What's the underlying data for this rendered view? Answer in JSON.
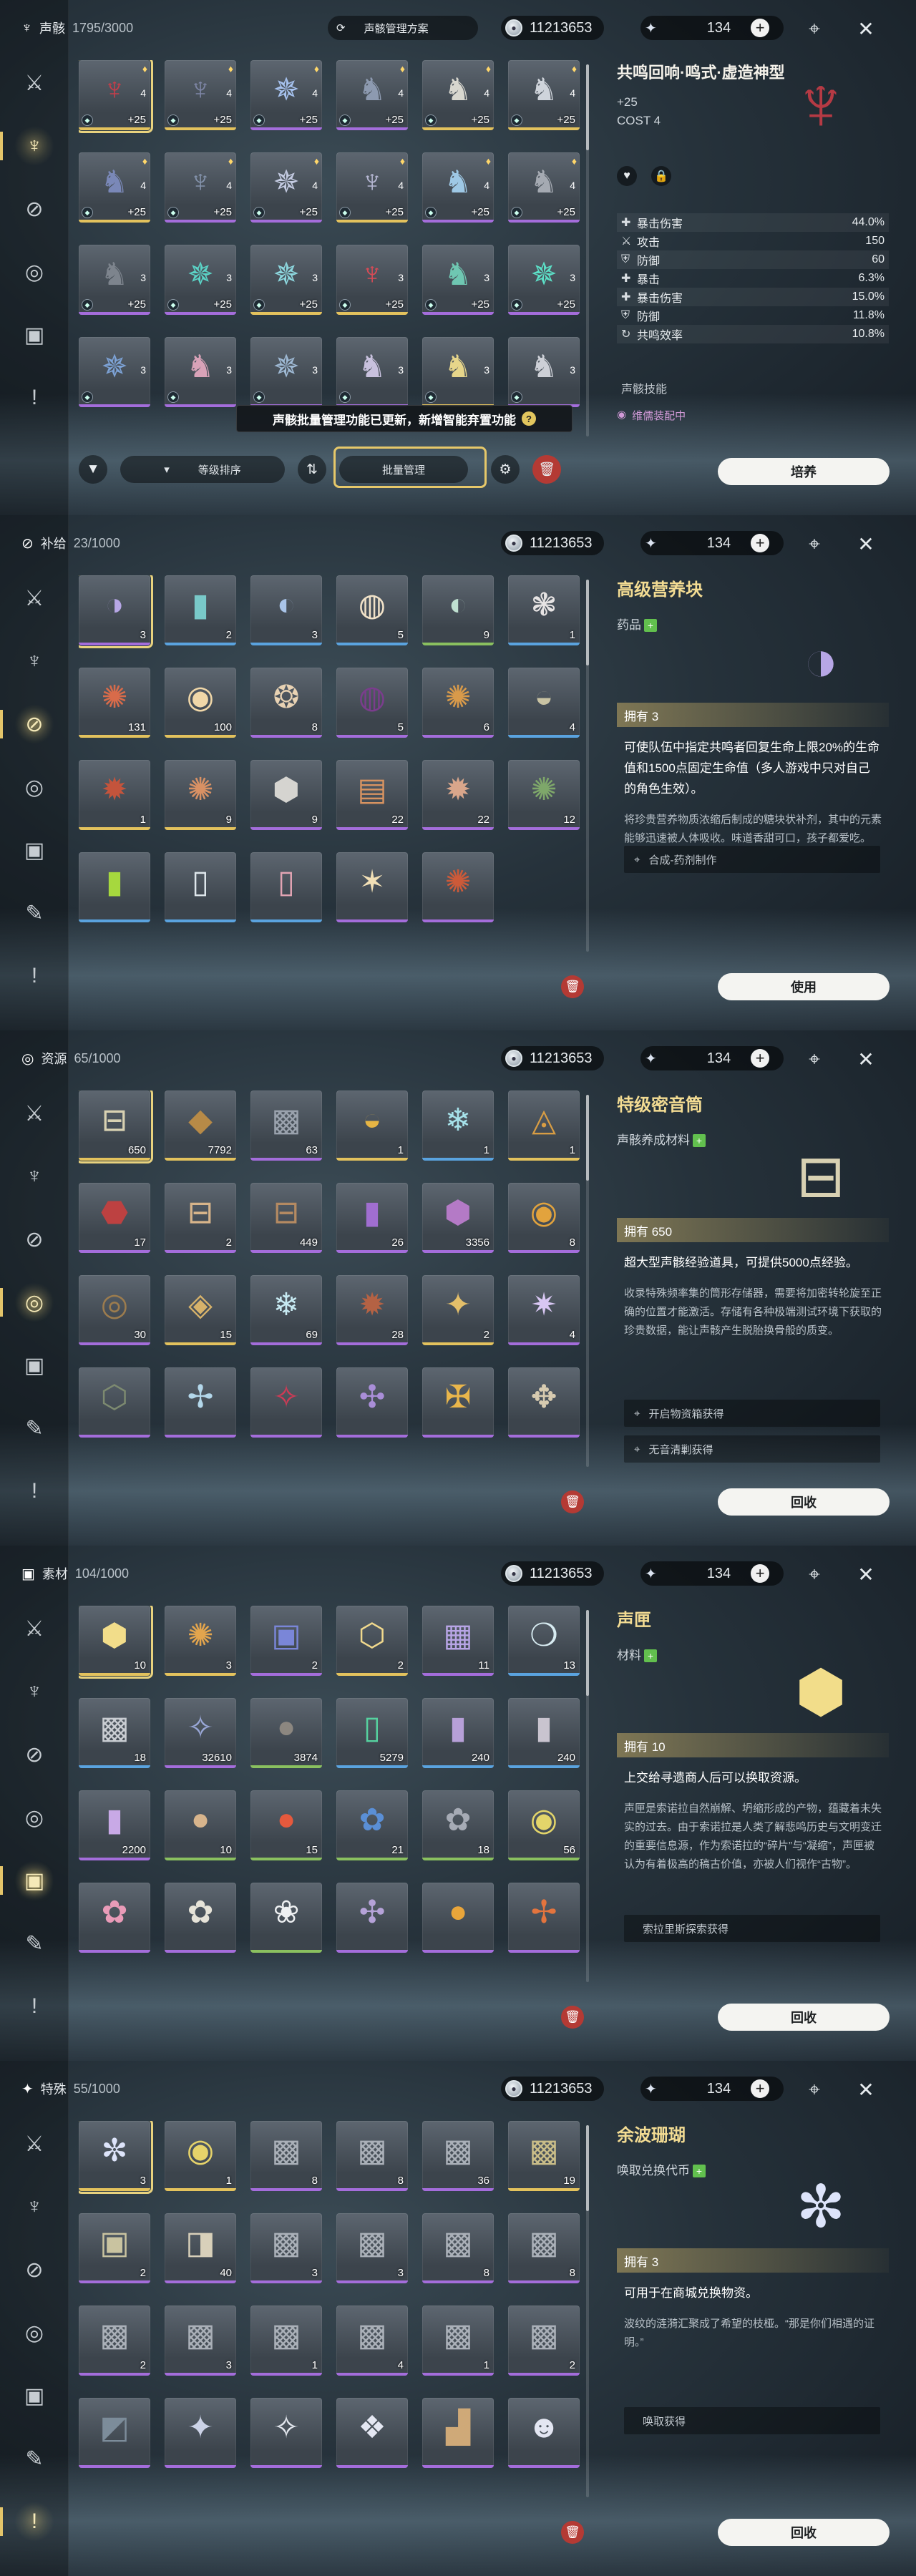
{
  "currency": {
    "shell_credits": "11213653",
    "astrite": "134"
  },
  "sidebar_tabs": [
    "combat",
    "echo",
    "supply",
    "resource",
    "material",
    "develop",
    "special"
  ],
  "panels": [
    {
      "category": "声骸",
      "count": "1795/3000",
      "scheme_label": "声骸管理方案",
      "detail": {
        "name": "共鸣回响·鸣式·虚造神型",
        "level": "+25",
        "cost_label": "COST",
        "cost_value": "4",
        "stats": [
          {
            "name": "暴击伤害",
            "value": "44.0%"
          },
          {
            "name": "攻击",
            "value": "150"
          },
          {
            "name": "防御",
            "value": "60"
          },
          {
            "name": "暴击",
            "value": "6.3%"
          },
          {
            "name": "暴击伤害",
            "value": "15.0%"
          },
          {
            "name": "防御",
            "value": "11.8%"
          },
          {
            "name": "共鸣效率",
            "value": "10.8%"
          }
        ],
        "skills_label": "声骸技能",
        "equipped_label": "维儒装配中",
        "action": "培养"
      },
      "sort_label": "等级排序",
      "batch_label": "批量管理",
      "tooltip": "声骸批量管理功能已更新，新增智能弃置功能",
      "items": [
        {
          "qty": "+25",
          "cost": "4"
        },
        {
          "qty": "+25",
          "cost": "4"
        },
        {
          "qty": "+25",
          "cost": "4"
        },
        {
          "qty": "+25",
          "cost": "4"
        },
        {
          "qty": "+25",
          "cost": "4"
        },
        {
          "qty": "+25",
          "cost": "4"
        },
        {
          "qty": "+25",
          "cost": "4"
        },
        {
          "qty": "+25",
          "cost": "4"
        },
        {
          "qty": "+25",
          "cost": "4"
        },
        {
          "qty": "+25",
          "cost": "4"
        },
        {
          "qty": "+25",
          "cost": "4"
        },
        {
          "qty": "+25",
          "cost": "4"
        },
        {
          "qty": "+25",
          "cost": "3"
        },
        {
          "qty": "+25",
          "cost": "3"
        },
        {
          "qty": "+25",
          "cost": "3"
        },
        {
          "qty": "+25",
          "cost": "3"
        },
        {
          "qty": "+25",
          "cost": "3"
        },
        {
          "qty": "+25",
          "cost": "3"
        },
        {
          "qty": "",
          "cost": "3"
        },
        {
          "qty": "",
          "cost": "3"
        },
        {
          "qty": "",
          "cost": "3"
        },
        {
          "qty": "",
          "cost": "3"
        },
        {
          "qty": "",
          "cost": "3"
        },
        {
          "qty": "",
          "cost": "3"
        }
      ]
    },
    {
      "category": "补给",
      "count": "23/1000",
      "detail": {
        "name": "高级营养块",
        "type": "药品",
        "own": "拥有 3",
        "desc1": "可使队伍中指定共鸣者回复生命上限20%的生命值和1500点固定生命值（多人游戏中只对自己的角色生效）。",
        "desc2": "将珍贵营养物质浓缩后制成的糖块状补剂，其中的元素能够迅速被人体吸收。味道香甜可口，孩子都爱吃。",
        "sources": [
          "合成-药剂制作"
        ],
        "action": "使用"
      },
      "items": [
        {
          "qty": "3"
        },
        {
          "qty": "2"
        },
        {
          "qty": "3"
        },
        {
          "qty": "5"
        },
        {
          "qty": "9"
        },
        {
          "qty": "1"
        },
        {
          "qty": "131"
        },
        {
          "qty": "100"
        },
        {
          "qty": "8"
        },
        {
          "qty": "5"
        },
        {
          "qty": "6"
        },
        {
          "qty": "4"
        },
        {
          "qty": "1"
        },
        {
          "qty": "9"
        },
        {
          "qty": "9"
        },
        {
          "qty": "22"
        },
        {
          "qty": "22"
        },
        {
          "qty": "12"
        },
        {
          "qty": ""
        },
        {
          "qty": ""
        },
        {
          "qty": ""
        },
        {
          "qty": ""
        },
        {
          "qty": ""
        }
      ]
    },
    {
      "category": "资源",
      "count": "65/1000",
      "detail": {
        "name": "特级密音筒",
        "type": "声骸养成材料",
        "own": "拥有 650",
        "desc1": "超大型声骸经验道具，可提供5000点经验。",
        "desc2": "收录特殊频率集的筒形存储器，需要将加密转轮旋至正确的位置才能激活。存储有各种极端测试环境下获取的珍贵数据，能让声骸产生脱胎换骨般的质变。",
        "sources": [
          "开启物资箱获得",
          "无音清剿获得"
        ],
        "action": "回收"
      },
      "items": [
        {
          "qty": "650"
        },
        {
          "qty": "7792"
        },
        {
          "qty": "63"
        },
        {
          "qty": "1"
        },
        {
          "qty": "1"
        },
        {
          "qty": "1"
        },
        {
          "qty": "17"
        },
        {
          "qty": "2"
        },
        {
          "qty": "449"
        },
        {
          "qty": "26"
        },
        {
          "qty": "3356"
        },
        {
          "qty": "8"
        },
        {
          "qty": "30"
        },
        {
          "qty": "15"
        },
        {
          "qty": "69"
        },
        {
          "qty": "28"
        },
        {
          "qty": "2"
        },
        {
          "qty": "4"
        },
        {
          "qty": ""
        },
        {
          "qty": ""
        },
        {
          "qty": ""
        },
        {
          "qty": ""
        },
        {
          "qty": ""
        },
        {
          "qty": ""
        }
      ]
    },
    {
      "category": "素材",
      "count": "104/1000",
      "detail": {
        "name": "声匣",
        "type": "材料",
        "own": "拥有 10",
        "desc1": "上交给寻遗商人后可以换取资源。",
        "desc2": "声匣是索诺拉自然崩解、坍缩形成的产物，蕴藏着未失实的过去。由于索诺拉是人类了解悲鸣历史与文明变迁的重要信息源，作为索诺拉的“碎片”与“凝缩”，声匣被认为有着极高的稿古价值，亦被人们视作“古物”。",
        "sources": [
          "索拉里斯探索获得"
        ],
        "action": "回收"
      },
      "items": [
        {
          "qty": "10"
        },
        {
          "qty": "3"
        },
        {
          "qty": "2"
        },
        {
          "qty": "2"
        },
        {
          "qty": "11"
        },
        {
          "qty": "13"
        },
        {
          "qty": "18"
        },
        {
          "qty": "32610"
        },
        {
          "qty": "3874"
        },
        {
          "qty": "5279"
        },
        {
          "qty": "240"
        },
        {
          "qty": "240"
        },
        {
          "qty": "2200"
        },
        {
          "qty": "10"
        },
        {
          "qty": "15"
        },
        {
          "qty": "21"
        },
        {
          "qty": "18"
        },
        {
          "qty": "56"
        },
        {
          "qty": ""
        },
        {
          "qty": ""
        },
        {
          "qty": ""
        },
        {
          "qty": ""
        },
        {
          "qty": ""
        },
        {
          "qty": ""
        }
      ]
    },
    {
      "category": "特殊",
      "count": "55/1000",
      "detail": {
        "name": "余波珊瑚",
        "type": "唤取兑换代币",
        "own": "拥有 3",
        "desc1": "可用于在商城兑换物资。",
        "desc2": "波纹的涟漪汇聚成了希望的枝桠。“那是你们相遇的证明。”",
        "sources": [
          "唤取获得"
        ],
        "action": "回收"
      },
      "items": [
        {
          "qty": "3"
        },
        {
          "qty": "1"
        },
        {
          "qty": "8"
        },
        {
          "qty": "8"
        },
        {
          "qty": "36"
        },
        {
          "qty": "19"
        },
        {
          "qty": "2"
        },
        {
          "qty": "40"
        },
        {
          "qty": "3"
        },
        {
          "qty": "3"
        },
        {
          "qty": "8"
        },
        {
          "qty": "8"
        },
        {
          "qty": "2"
        },
        {
          "qty": "3"
        },
        {
          "qty": "1"
        },
        {
          "qty": "4"
        },
        {
          "qty": "1"
        },
        {
          "qty": "2"
        },
        {
          "qty": ""
        },
        {
          "qty": ""
        },
        {
          "qty": ""
        },
        {
          "qty": ""
        },
        {
          "qty": ""
        },
        {
          "qty": ""
        }
      ]
    }
  ]
}
